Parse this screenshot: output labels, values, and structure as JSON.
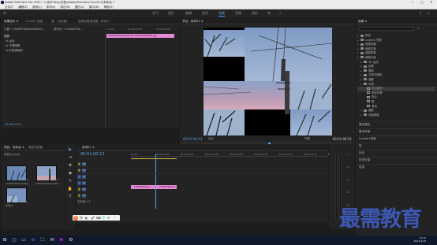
{
  "window": {
    "title": "Adobe Premiere Pro 2020 - C:\\用户\\Dxy\\文档\\Adobe\\Premiere Pro\\14.0\\未命名 *",
    "controls": [
      "—",
      "□",
      "✕"
    ]
  },
  "menubar": [
    "文件(F)",
    "编辑(E)",
    "剪辑(C)",
    "序列(S)",
    "标记(M)",
    "图形(G)",
    "窗口(W)",
    "帮助(H)"
  ],
  "workspaces": {
    "items": [
      "学习",
      "组件",
      "编辑",
      "颜色",
      "效果",
      "音频",
      "图形",
      "库"
    ],
    "active_index": 4,
    "more": "»"
  },
  "effect_controls": {
    "tabs": [
      "效果控件 ≡",
      "Lumetri 范围",
      "源：(无剪辑)",
      "音频剪辑混合器：序列01"
    ],
    "master": "主要 * 1280873b61ee69232...",
    "sequence": "序列01 * 1280873b...",
    "section_video": "视频",
    "fx_items": [
      "fx  运动",
      "fx  不透明度",
      "fx  时间重映射"
    ],
    "ruler_start": "00:00",
    "ruler_mid": "00:00:05:00",
    "ruler_end": "00:00:10:00",
    "clip_name": "1280873b61ee69232c2595123fd089.jpg",
    "timecode": "00:00:00:13"
  },
  "program": {
    "tab": "节目：序列01 ≡",
    "timecode_left": "00:01:00:13",
    "fit": "适合",
    "full": "完整",
    "timecode_right": "00:01:00:21",
    "controls": [
      "◆",
      "{",
      "}",
      "|←",
      "◀|",
      "▶",
      "|▶",
      "→|",
      "⊡",
      "⊞",
      "⎘",
      "📷",
      "⊕",
      "+"
    ]
  },
  "effects_panel": {
    "tab": "效果 ≡",
    "search_placeholder": "",
    "tree": [
      {
        "label": "预设",
        "depth": 0,
        "kind": "folder"
      },
      {
        "label": "Lumetri 预设",
        "depth": 0,
        "kind": "folder"
      },
      {
        "label": "音频效果",
        "depth": 0,
        "kind": "folder"
      },
      {
        "label": "音频过渡",
        "depth": 0,
        "kind": "folder"
      },
      {
        "label": "视频效果",
        "depth": 0,
        "kind": "folder"
      },
      {
        "label": "视频过渡",
        "depth": 0,
        "kind": "folder"
      },
      {
        "label": "3D 运动",
        "depth": 1,
        "kind": "folder"
      },
      {
        "label": "划像",
        "depth": 1,
        "kind": "folder"
      },
      {
        "label": "擦除",
        "depth": 1,
        "kind": "folder"
      },
      {
        "label": "沉浸式视频",
        "depth": 1,
        "kind": "folder"
      },
      {
        "label": "溶解",
        "depth": 1,
        "kind": "folder"
      },
      {
        "label": "内滑",
        "depth": 1,
        "kind": "folder"
      },
      {
        "label": "中心拆分",
        "depth": 2,
        "kind": "fx",
        "selected": true
      },
      {
        "label": "带状内滑",
        "depth": 2,
        "kind": "fx"
      },
      {
        "label": "拆分",
        "depth": 2,
        "kind": "fx"
      },
      {
        "label": "推",
        "depth": 2,
        "kind": "fx"
      },
      {
        "label": "滑动",
        "depth": 2,
        "kind": "fx"
      },
      {
        "label": "缩放",
        "depth": 1,
        "kind": "folder"
      },
      {
        "label": "页面剥落",
        "depth": 1,
        "kind": "folder"
      }
    ],
    "sections": [
      "基本图形",
      "基本声音",
      "Lumetri 颜色",
      "库",
      "标记",
      "历史记录",
      "信息"
    ]
  },
  "project": {
    "tabs": [
      "项目：未命名 ≡",
      "媒体浏览器"
    ],
    "file": "未命名.prproj",
    "items": [
      {
        "name": "1280873b61ee692...",
        "dur": "5:00"
      },
      {
        "name": "1280873b61ee692...",
        "dur": "5:00"
      },
      {
        "name": "序列01",
        "dur": "10:00"
      }
    ]
  },
  "tools": [
    "▶",
    "⇥",
    "✥",
    "◆",
    "✎",
    "✋",
    "T"
  ],
  "timeline": {
    "tab": "序列01 ≡",
    "timecode": "00:01:00:13",
    "ticks": [
      "00:00",
      "00:00:05:00",
      "00:00:10:00",
      "00:00:15:00",
      "00:00:20:00",
      "00:00:25:00",
      "00:00:30:00",
      "00:00:35:00",
      "00:00:40:00"
    ],
    "tracks": [
      "V3",
      "V2",
      "V1",
      "A1",
      "A2",
      "A3",
      "主声道"
    ],
    "clips": [
      "1280873b61ee...",
      "1280873b61ee..."
    ],
    "master_value": "0.0"
  },
  "meter": {
    "labels": [
      "0",
      "-12",
      "-24",
      "-36",
      "-48",
      "dB"
    ]
  },
  "ime": [
    "S",
    "中",
    "◐",
    "🎤",
    "⌨",
    "👕",
    "✦",
    "⋮"
  ],
  "taskbar": {
    "icons": [
      "⊞",
      "○",
      "▭",
      "e",
      "🗀",
      "✉",
      "Pr",
      "⚙"
    ],
    "time": "11:12",
    "date": "2021/1/18"
  },
  "watermark": "最需教育",
  "colors": {
    "accent_blue": "#5aa3e8",
    "clip_pink": "#e58ad6",
    "panel_bg": "#232323",
    "watermark": "#3c57b4"
  }
}
